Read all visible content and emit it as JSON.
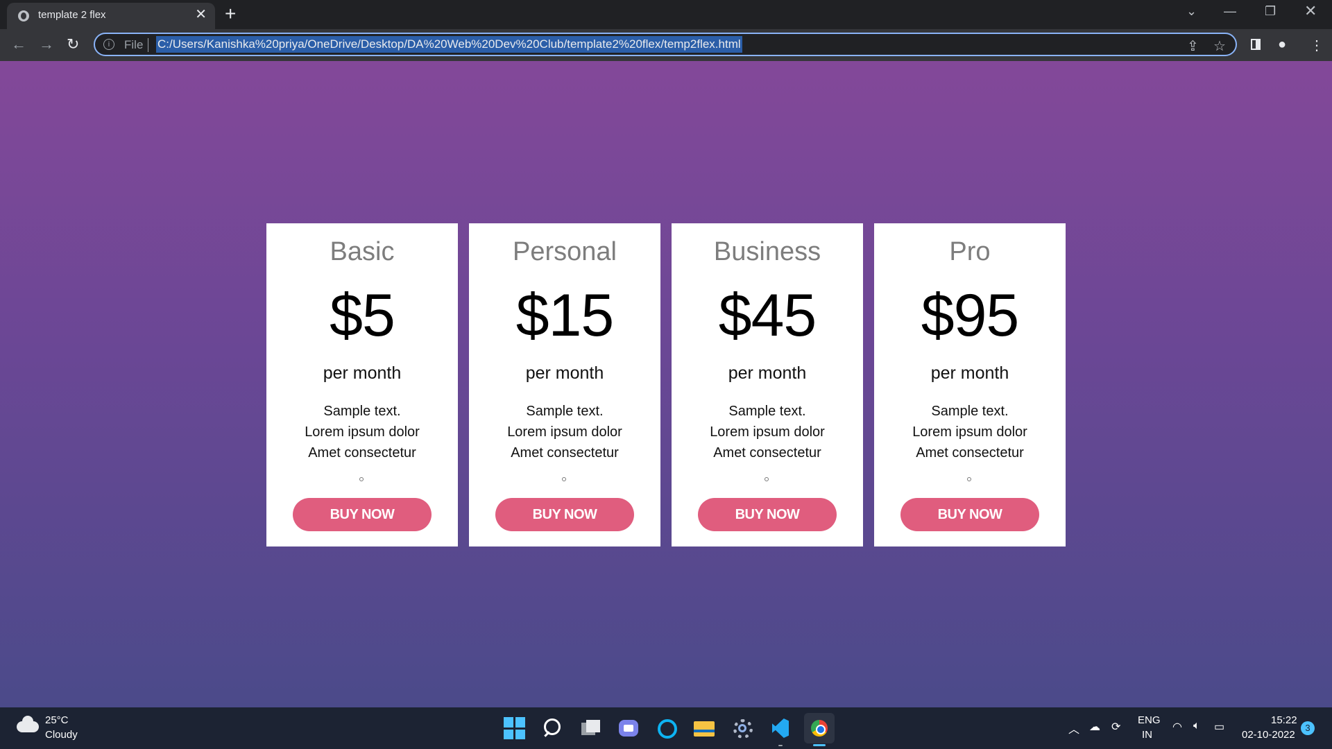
{
  "browser": {
    "tab_title": "template 2 flex",
    "tab_close": "✕",
    "new_tab": "+",
    "scheme_label": "File",
    "url": "C:/Users/Kanishka%20priya/OneDrive/Desktop/DA%20Web%20Dev%20Club/template2%20flex/temp2flex.html",
    "icons": [
      "globe-icon",
      "close-icon",
      "plus-icon",
      "chevron-down-icon",
      "minimize-icon",
      "restore-icon",
      "close-window-icon",
      "back-icon",
      "forward-icon",
      "reload-icon",
      "info-icon",
      "share-icon",
      "star-icon",
      "side-panel-icon",
      "profile-icon",
      "menu-icon"
    ]
  },
  "pricing": {
    "plans": [
      {
        "name": "Basic",
        "price": "$5",
        "period": "per month",
        "features": [
          "Sample text.",
          "Lorem ipsum dolor",
          "Amet consectetur"
        ],
        "cta": "BUY NOW"
      },
      {
        "name": "Personal",
        "price": "$15",
        "period": "per month",
        "features": [
          "Sample text.",
          "Lorem ipsum dolor",
          "Amet consectetur"
        ],
        "cta": "BUY NOW"
      },
      {
        "name": "Business",
        "price": "$45",
        "period": "per month",
        "features": [
          "Sample text.",
          "Lorem ipsum dolor",
          "Amet consectetur"
        ],
        "cta": "BUY NOW"
      },
      {
        "name": "Pro",
        "price": "$95",
        "period": "per month",
        "features": [
          "Sample text.",
          "Lorem ipsum dolor",
          "Amet consectetur"
        ],
        "cta": "BUY NOW"
      }
    ],
    "colors": {
      "button": "#e05d7e",
      "plan_name": "#7d7d7d",
      "background_top": "#834899",
      "background_bottom": "#4b4a8a"
    }
  },
  "taskbar": {
    "weather": {
      "temp": "25°C",
      "condition": "Cloudy"
    },
    "apps": [
      "start-icon",
      "search-icon",
      "task-view-icon",
      "teams-icon",
      "cortana-icon",
      "file-explorer-icon",
      "settings-icon",
      "vscode-icon",
      "chrome-icon"
    ],
    "tray": {
      "lang_line1": "ENG",
      "lang_line2": "IN",
      "time": "15:22",
      "date": "02-10-2022",
      "notifications": "3"
    }
  }
}
